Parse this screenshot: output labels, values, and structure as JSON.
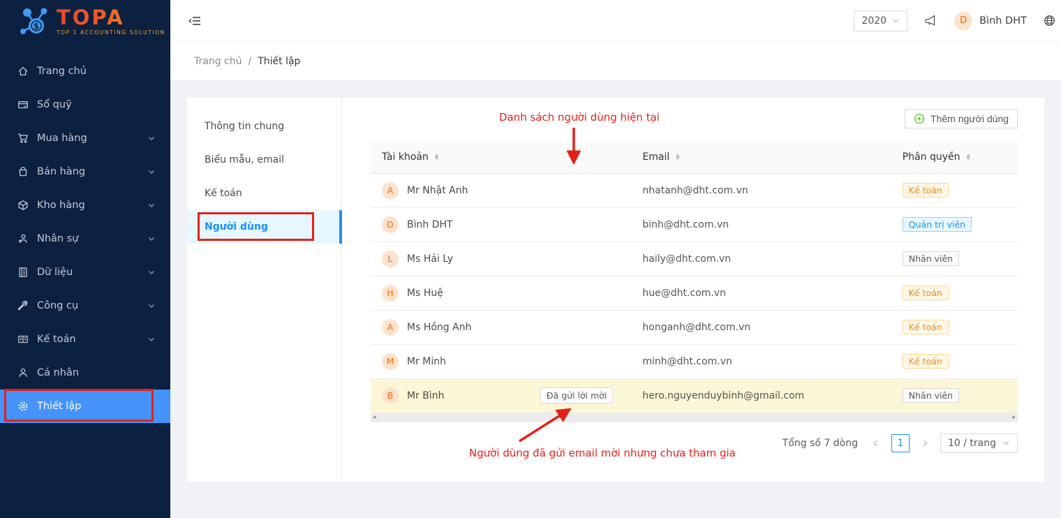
{
  "logo": {
    "brand": "TOPA",
    "subtitle": "TOP 1 ACCOUNTING SOLUTION"
  },
  "sidebar": {
    "items": [
      {
        "label": "Trang chủ",
        "icon": "home-icon",
        "expandable": false,
        "active": false
      },
      {
        "label": "Sổ quỹ",
        "icon": "cash-book-icon",
        "expandable": false,
        "active": false
      },
      {
        "label": "Mua hàng",
        "icon": "cart-icon",
        "expandable": true,
        "active": false
      },
      {
        "label": "Bán hàng",
        "icon": "bag-icon",
        "expandable": true,
        "active": false
      },
      {
        "label": "Kho hàng",
        "icon": "cube-icon",
        "expandable": true,
        "active": false
      },
      {
        "label": "Nhân sự",
        "icon": "staff-icon",
        "expandable": true,
        "active": false
      },
      {
        "label": "Dữ liệu",
        "icon": "data-icon",
        "expandable": true,
        "active": false
      },
      {
        "label": "Công cụ",
        "icon": "tools-icon",
        "expandable": true,
        "active": false
      },
      {
        "label": "Kế toán",
        "icon": "ledger-icon",
        "expandable": true,
        "active": false
      },
      {
        "label": "Cá nhân",
        "icon": "person-icon",
        "expandable": false,
        "active": false
      },
      {
        "label": "Thiết lập",
        "icon": "gear-icon",
        "expandable": false,
        "active": true
      }
    ]
  },
  "header": {
    "year": "2020",
    "user": {
      "initial": "D",
      "name": "Bình DHT"
    }
  },
  "breadcrumb": {
    "home": "Trang chủ",
    "separator": "/",
    "current": "Thiết lập"
  },
  "settings_tabs": {
    "items": [
      {
        "label": "Thông tin chung",
        "active": false
      },
      {
        "label": "Biểu mẫu, email",
        "active": false
      },
      {
        "label": "Kế toán",
        "active": false
      },
      {
        "label": "Người dùng",
        "active": true
      }
    ]
  },
  "users": {
    "add_button": "Thêm người dùng",
    "columns": {
      "account": "Tài khoản",
      "email": "Email",
      "role": "Phân quyền"
    },
    "rows": [
      {
        "initial": "A",
        "name": "Mr Nhật Anh",
        "email": "nhatanh@dht.com.vn",
        "role": "Kế toán",
        "role_type": "orange",
        "highlight": false
      },
      {
        "initial": "D",
        "name": "Bình DHT",
        "email": "binh@dht.com.vn",
        "role": "Quản trị viên",
        "role_type": "blue",
        "highlight": false
      },
      {
        "initial": "L",
        "name": "Ms Hải Ly",
        "email": "haily@dht.com.vn",
        "role": "Nhân viên",
        "role_type": "default",
        "highlight": false
      },
      {
        "initial": "H",
        "name": "Ms Huệ",
        "email": "hue@dht.com.vn",
        "role": "Kế toán",
        "role_type": "orange",
        "highlight": false
      },
      {
        "initial": "A",
        "name": "Ms Hồng Anh",
        "email": "honganh@dht.com.vn",
        "role": "Kế toán",
        "role_type": "orange",
        "highlight": false
      },
      {
        "initial": "M",
        "name": "Mr Minh",
        "email": "minh@dht.com.vn",
        "role": "Kế toán",
        "role_type": "orange",
        "highlight": false
      },
      {
        "initial": "B",
        "name": "Mr Bình",
        "email": "hero.nguyenduybinh@gmail.com",
        "role": "Nhân viên",
        "role_type": "default",
        "highlight": true,
        "invited_tag": "Đã gửi lời mời"
      }
    ],
    "pagination": {
      "total": "Tổng số 7 dòng",
      "page": "1",
      "page_size": "10 / trang"
    }
  },
  "annotations": {
    "top_label": "Danh sách người dùng hiện tại",
    "bottom_label": "Người dùng đã gửi email mời nhưng chưa tham gia"
  },
  "colors": {
    "accent": "#1890ff",
    "sidebar_bg": "#0c2040",
    "sidebar_active": "#4593fb",
    "annotation_red": "#e32119",
    "avatar_bg": "#fde3cf",
    "avatar_text": "#f56a00",
    "highlight_row": "#fbf6d5",
    "tag_orange_text": "#fa8c16",
    "tag_blue_text": "#1890ff",
    "page_bg": "#f0f2f5"
  }
}
